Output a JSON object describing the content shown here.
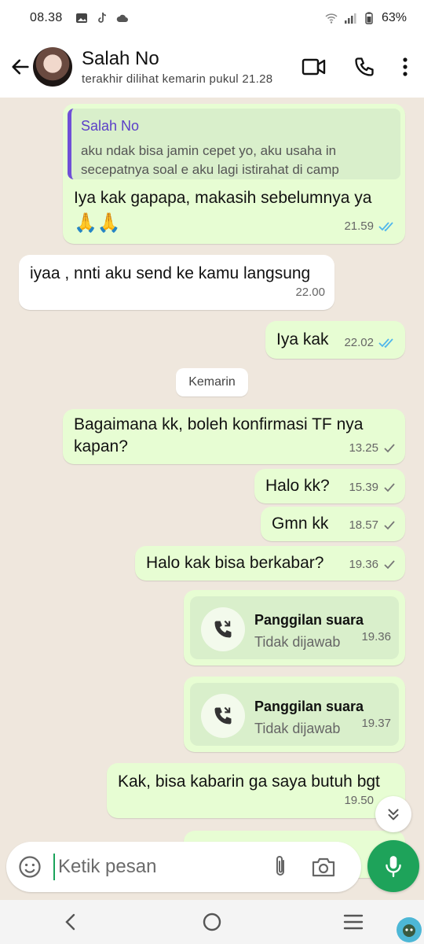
{
  "status_bar": {
    "time": "08.38",
    "battery": "63%",
    "icons": [
      "image-icon",
      "tiktok-icon",
      "cloud-icon",
      "wifi-icon",
      "signal-icon",
      "battery-icon"
    ]
  },
  "header": {
    "contact_name": "Salah No",
    "last_seen": "terakhir dilihat kemarin pukul 21.28",
    "icons": [
      "back-arrow-icon",
      "video-call-icon",
      "phone-icon",
      "more-vert-icon"
    ]
  },
  "messages": [
    {
      "direction": "out",
      "quote": {
        "name": "Salah No",
        "line1": "aku ndak bisa jamin cepet yo, aku usaha in",
        "line2": "secepatnya soal e aku lagi istirahat di camp"
      },
      "text": "Iya kak gapapa, makasih sebelumnya ya",
      "emoji": "🙏🙏",
      "time": "21.59",
      "status": "read"
    },
    {
      "direction": "in",
      "text": "iyaa , nnti aku send ke kamu langsung",
      "time": "22.00"
    },
    {
      "direction": "out",
      "text": "Iya kak",
      "time": "22.02",
      "status": "read"
    },
    {
      "direction": "out",
      "text": "Bagaimana kk, boleh konfirmasi TF nya kapan?",
      "time": "13.25",
      "status": "sent"
    },
    {
      "direction": "out",
      "text": "Halo kk?",
      "time": "15.39",
      "status": "sent"
    },
    {
      "direction": "out",
      "text": "Gmn kk",
      "time": "18.57",
      "status": "sent"
    },
    {
      "direction": "out",
      "text": "Halo kak bisa berkabar?",
      "time": "19.36",
      "status": "sent"
    },
    {
      "direction": "out",
      "type": "call",
      "title": "Panggilan suara",
      "subtitle": "Tidak dijawab",
      "time": "19.36"
    },
    {
      "direction": "out",
      "type": "call",
      "title": "Panggilan suara",
      "subtitle": "Tidak dijawab",
      "time": "19.37"
    },
    {
      "direction": "out",
      "text": "Kak, bisa kabarin ga saya butuh bgt",
      "time": "19.50"
    }
  ],
  "date_divider": "Kemarin",
  "compose": {
    "placeholder": "Ketik pesan"
  },
  "colors": {
    "outgoing_bubble": "#e7fdd3",
    "incoming_bubble": "#ffffff",
    "chat_background": "#efe7dd",
    "accent_green": "#1ea35a",
    "read_tick": "#4fb6ec",
    "quote_bar": "#6f4fd7"
  }
}
